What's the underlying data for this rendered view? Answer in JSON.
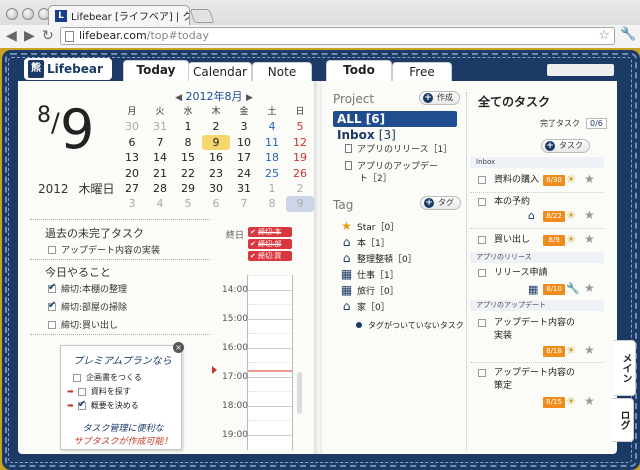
{
  "browser": {
    "tab_title": "Lifebear [ライフベア] | クラウ",
    "tab_favicon": "L",
    "url_host": "lifebear.com",
    "url_path": "/top#today"
  },
  "app": {
    "logo_text": "Lifebear",
    "left_tabs": [
      "Today",
      "Calendar",
      "Note"
    ],
    "right_tabs": [
      "Todo",
      "Free"
    ]
  },
  "today": {
    "month": "8",
    "day": "9",
    "year": "2012",
    "weekday": "木曜日"
  },
  "calendar": {
    "title": "2012年8月",
    "weekdays": [
      "月",
      "火",
      "水",
      "木",
      "金",
      "土",
      "日"
    ],
    "weeks": [
      [
        "30",
        "31",
        "1",
        "2",
        "3",
        "4",
        "5"
      ],
      [
        "6",
        "7",
        "8",
        "9",
        "10",
        "11",
        "12"
      ],
      [
        "13",
        "14",
        "15",
        "16",
        "17",
        "18",
        "19"
      ],
      [
        "20",
        "21",
        "22",
        "23",
        "24",
        "25",
        "26"
      ],
      [
        "27",
        "28",
        "29",
        "30",
        "31",
        "1",
        "2"
      ],
      [
        "3",
        "4",
        "5",
        "6",
        "7",
        "8",
        "9"
      ]
    ]
  },
  "overdue": {
    "title": "過去の未完了タスク",
    "items": [
      {
        "label": "アップデート内容の実装",
        "checked": false
      }
    ]
  },
  "todaytasks": {
    "title": "今日やること",
    "items": [
      {
        "label": "締切:本棚の整理",
        "checked": true
      },
      {
        "label": "締切:部屋の掃除",
        "checked": true
      },
      {
        "label": "締切:買い出し",
        "checked": false
      }
    ]
  },
  "timeline": {
    "deadline_label": "終日",
    "deadlines": [
      "締切:本",
      "締切:部",
      "締切:買"
    ],
    "hours": [
      "14:00",
      "15:00",
      "16:00",
      "17:00",
      "18:00",
      "19:00"
    ]
  },
  "premium": {
    "title": "プレミアムプランなら",
    "close": "×",
    "items": [
      {
        "label": "企画書をつくる",
        "checked": false
      },
      {
        "label": "資料を探す",
        "checked": false
      },
      {
        "label": "概要を決める",
        "checked": true
      }
    ],
    "footer1": "タスク管理に便利な",
    "footer2": "サブタスクが作成可能！"
  },
  "projects": {
    "title": "Project",
    "create_label": "作成",
    "all_label": "ALL",
    "all_count": "[6]",
    "inbox_label": "Inbox",
    "inbox_count": "[3]",
    "sub": [
      "アプリのリリース［1］",
      "アプリのアップデー",
      "ト［2］"
    ]
  },
  "tags": {
    "title": "Tag",
    "create_label": "タグ",
    "items": [
      {
        "label": "Star［0］",
        "icon": "star-icon"
      },
      {
        "label": "本［1］",
        "icon": "home-icon"
      },
      {
        "label": "整理整頓［0］",
        "icon": "home-icon"
      },
      {
        "label": "仕事［1］",
        "icon": "building-icon"
      },
      {
        "label": "旅行［0］",
        "icon": "building-icon"
      },
      {
        "label": "家［0］",
        "icon": "home-icon"
      }
    ],
    "untagged": "タグがついていないタスク"
  },
  "alltasks": {
    "title": "全てのタスク",
    "done_label": "完了タスク",
    "done_count": "0/6",
    "add_label": "タスク",
    "groups": [
      "Inbox",
      "アプリのリリース",
      "アプリのアップデート"
    ],
    "tasks": [
      {
        "label": "資料の購入",
        "date": "8/30"
      },
      {
        "label": "本の予約",
        "date": "8/22"
      },
      {
        "label": "買い出し",
        "date": "8/9"
      },
      {
        "label": "リリース申請",
        "date": "8/10"
      },
      {
        "label": "アップデート内容の",
        "label2": "実装",
        "date": "8/18"
      },
      {
        "label": "アップデート内容の",
        "label2": "策定",
        "date": "8/15"
      }
    ]
  },
  "sidetabs": [
    "メイン",
    "ログ"
  ],
  "colors": {
    "navy": "#1b3a66",
    "accent_blue": "#1f4d8f",
    "today_yellow": "#f5d76e",
    "date_orange": "#f08c1c",
    "deadline_red": "#d9363e",
    "desk": "#c9a227"
  }
}
